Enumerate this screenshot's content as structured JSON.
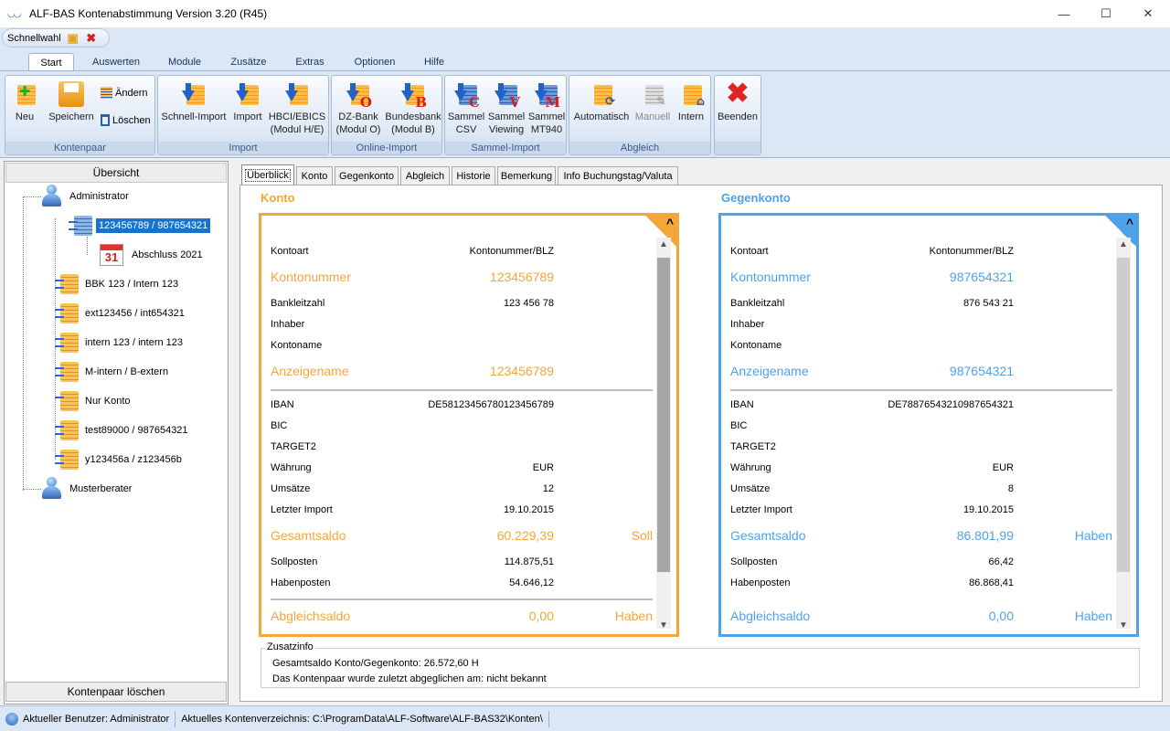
{
  "window": {
    "title": "ALF-BAS Kontenabstimmung Version 3.20 (R45)"
  },
  "quickaccess": {
    "label": "Schnellwahl"
  },
  "ribbon": {
    "tabs": [
      "Start",
      "Auswerten",
      "Module",
      "Zusätze",
      "Extras",
      "Optionen",
      "Hilfe"
    ],
    "active_tab": "Start",
    "groups": {
      "kontenpaar": {
        "label": "Kontenpaar",
        "neu": "Neu",
        "speichern": "Speichern",
        "aendern": "Ändern",
        "loeschen": "Löschen"
      },
      "import": {
        "label": "Import",
        "schnell": "Schnell-Import",
        "import": "Import",
        "hbci1": "HBCI/EBICS",
        "hbci2": "(Modul H/E)"
      },
      "online": {
        "label": "Online-Import",
        "dz1": "DZ-Bank",
        "dz2": "(Modul O)",
        "bb1": "Bundesbank",
        "bb2": "(Modul B)"
      },
      "sammel": {
        "label": "Sammel-Import",
        "csv1": "Sammel",
        "csv2": "CSV",
        "view1": "Sammel",
        "view2": "Viewing",
        "mt1": "Sammel",
        "mt2": "MT940"
      },
      "abgleich": {
        "label": "Abgleich",
        "auto": "Automatisch",
        "manuell": "Manuell",
        "intern": "Intern"
      },
      "beenden": {
        "label": "Beenden"
      }
    }
  },
  "left": {
    "header": "Übersicht",
    "tree": {
      "admin": "Administrator",
      "accounts": [
        "123456789 / 987654321",
        "BBK 123 / Intern 123",
        "ext123456 / int654321",
        "intern 123 / intern 123",
        "M-intern / B-extern",
        "Nur Konto",
        "test89000 / 987654321",
        "y123456a / z123456b"
      ],
      "abschluss": "Abschluss 2021",
      "cal_day": "31",
      "musterberater": "Musterberater"
    },
    "delete_button": "Kontenpaar löschen"
  },
  "detail_tabs": [
    "Überblick",
    "Konto",
    "Gegenkonto",
    "Abgleich",
    "Historie",
    "Bemerkung",
    "Info Buchungstag/Valuta"
  ],
  "konto": {
    "heading": "Konto",
    "kontoart_label": "Kontoart",
    "kontoart": "Kontonummer/BLZ",
    "kontonummer_label": "Kontonummer",
    "kontonummer": "123456789",
    "blz_label": "Bankleitzahl",
    "blz": "123 456 78",
    "inhaber_label": "Inhaber",
    "kontoname_label": "Kontoname",
    "anzeigename_label": "Anzeigename",
    "anzeigename": "123456789",
    "iban_label": "IBAN",
    "iban": "DE58123456780123456789",
    "bic_label": "BIC",
    "target2_label": "TARGET2",
    "waehrung_label": "Währung",
    "waehrung": "EUR",
    "umsaetze_label": "Umsätze",
    "umsaetze": "12",
    "import_label": "Letzter Import",
    "import": "19.10.2015",
    "gesamt_label": "Gesamtsaldo",
    "gesamt": "60.229,39",
    "gesamt_side": "Soll",
    "soll_label": "Sollposten",
    "soll": "114.875,51",
    "haben_label": "Habenposten",
    "haben": "54.646,12",
    "abgleich_label": "Abgleichsaldo",
    "abgleich": "0,00",
    "abgleich_side": "Haben"
  },
  "gegenkonto": {
    "heading": "Gegenkonto",
    "kontoart_label": "Kontoart",
    "kontoart": "Kontonummer/BLZ",
    "kontonummer_label": "Kontonummer",
    "kontonummer": "987654321",
    "blz_label": "Bankleitzahl",
    "blz": "876 543 21",
    "inhaber_label": "Inhaber",
    "kontoname_label": "Kontoname",
    "anzeigename_label": "Anzeigename",
    "anzeigename": "987654321",
    "iban_label": "IBAN",
    "iban": "DE78876543210987654321",
    "bic_label": "BIC",
    "target2_label": "TARGET2",
    "waehrung_label": "Währung",
    "waehrung": "EUR",
    "umsaetze_label": "Umsätze",
    "umsaetze": "8",
    "import_label": "Letzter Import",
    "import": "19.10.2015",
    "gesamt_label": "Gesamtsaldo",
    "gesamt": "86.801,99",
    "gesamt_side": "Haben",
    "soll_label": "Sollposten",
    "soll": "66,42",
    "haben_label": "Habenposten",
    "haben": "86.868,41",
    "abgleich_label": "Abgleichsaldo",
    "abgleich": "0,00",
    "abgleich_side": "Haben"
  },
  "zusatz": {
    "label": "Zusatzinfo",
    "line1": "Gesamtsaldo Konto/Gegenkonto: 26.572,60 H",
    "line2": "Das Kontenpaar wurde zuletzt abgeglichen am:  nicht bekannt"
  },
  "status": {
    "user": "Aktueller Benutzer: Administrator",
    "dir": "Aktuelles Kontenverzeichnis: C:\\ProgramData\\ALF-Software\\ALF-BAS32\\Konten\\"
  },
  "colors": {
    "konto": "#f3a63a",
    "gegenkonto": "#4ea2e8",
    "selection": "#1a73c9"
  }
}
